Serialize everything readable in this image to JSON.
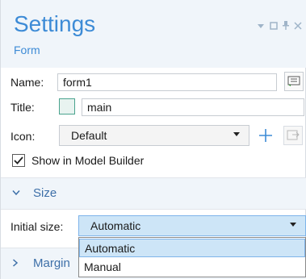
{
  "header": {
    "title": "Settings",
    "subtitle": "Form"
  },
  "fields": {
    "name_label": "Name:",
    "name_value": "form1",
    "title_label": "Title:",
    "title_value": "main",
    "icon_label": "Icon:",
    "icon_value": "Default",
    "show_in_model_builder": "Show in Model Builder",
    "show_in_model_builder_checked": true
  },
  "sections": {
    "size": "Size",
    "margins": "Margin"
  },
  "size": {
    "initial_size_label": "Initial size:",
    "initial_size_value": "Automatic",
    "options": [
      "Automatic",
      "Manual"
    ]
  },
  "icons": {
    "panel_menu": "chevron-down-icon",
    "restore": "restore-icon",
    "pin": "pin-icon",
    "close": "close-icon",
    "name_edit": "edit-label-icon",
    "add": "plus-icon",
    "import": "import-icon"
  },
  "colors": {
    "accent": "#3d8bd6",
    "header_bg": "#f0f5fa",
    "selection_bg": "#cde5f7",
    "selection_border": "#7eb4ea"
  }
}
